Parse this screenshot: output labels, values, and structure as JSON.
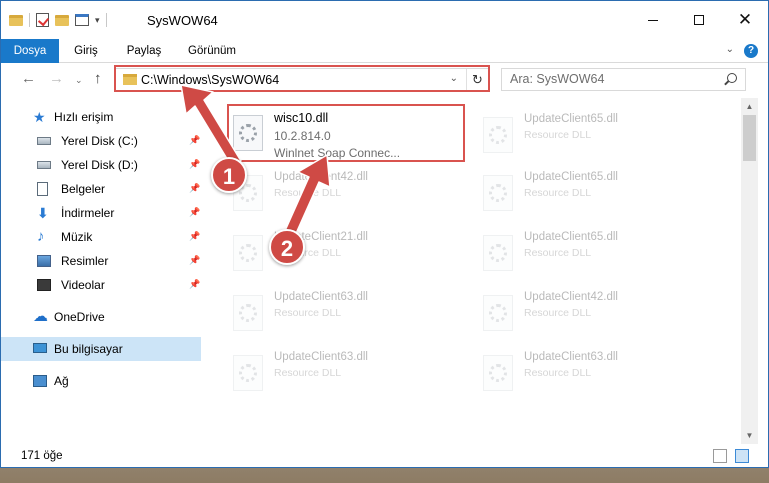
{
  "title_bar": {
    "title": "SysWOW64"
  },
  "ribbon": {
    "tabs": [
      "Dosya",
      "Giriş",
      "Paylaş",
      "Görünüm"
    ],
    "help": "?"
  },
  "address": {
    "path": "C:\\Windows\\SysWOW64",
    "search_placeholder": "Ara: SysWOW64"
  },
  "nav_pane": {
    "items": [
      {
        "label": "Hızlı erişim",
        "icon": "star-icon"
      },
      {
        "label": "Yerel Disk (C:)",
        "icon": "drive-icon",
        "pinned": true
      },
      {
        "label": "Yerel Disk (D:)",
        "icon": "drive-icon",
        "pinned": true
      },
      {
        "label": "Belgeler",
        "icon": "document-icon",
        "pinned": true
      },
      {
        "label": "İndirmeler",
        "icon": "download-icon",
        "pinned": true
      },
      {
        "label": "Müzik",
        "icon": "music-icon",
        "pinned": true
      },
      {
        "label": "Resimler",
        "icon": "pictures-icon",
        "pinned": true
      },
      {
        "label": "Videolar",
        "icon": "video-icon",
        "pinned": true
      },
      {
        "label": "OneDrive",
        "icon": "cloud-icon"
      },
      {
        "label": "Bu bilgisayar",
        "icon": "computer-icon",
        "selected": true
      },
      {
        "label": "Ağ",
        "icon": "network-icon"
      }
    ]
  },
  "files": {
    "highlighted": {
      "name": "wisc10.dll",
      "version": "10.2.814.0",
      "description": "Winlnet Soap Connec..."
    },
    "background": [
      {
        "name": "UpdateClient65.dll",
        "type": "Resource DLL"
      },
      {
        "name": "UpdateClient42.dll",
        "type": "Resource DLL"
      },
      {
        "name": "UpdateClient65.dll",
        "type": "Resource DLL"
      },
      {
        "name": "UpdateClient21.dll",
        "type": "Resource DLL"
      },
      {
        "name": "UpdateClient65.dll",
        "type": "Resource DLL"
      },
      {
        "name": "UpdateClient63.dll",
        "type": "Resource DLL"
      },
      {
        "name": "UpdateClient42.dll",
        "type": "Resource DLL"
      },
      {
        "name": "UpdateClient63.dll",
        "type": "Resource DLL"
      },
      {
        "name": "UpdateClient63.dll",
        "type": "Resource DLL"
      }
    ]
  },
  "status_bar": {
    "item_count": "171 öğe"
  },
  "annotations": {
    "badge_1": "1",
    "badge_2": "2",
    "color": "#d9534f"
  }
}
